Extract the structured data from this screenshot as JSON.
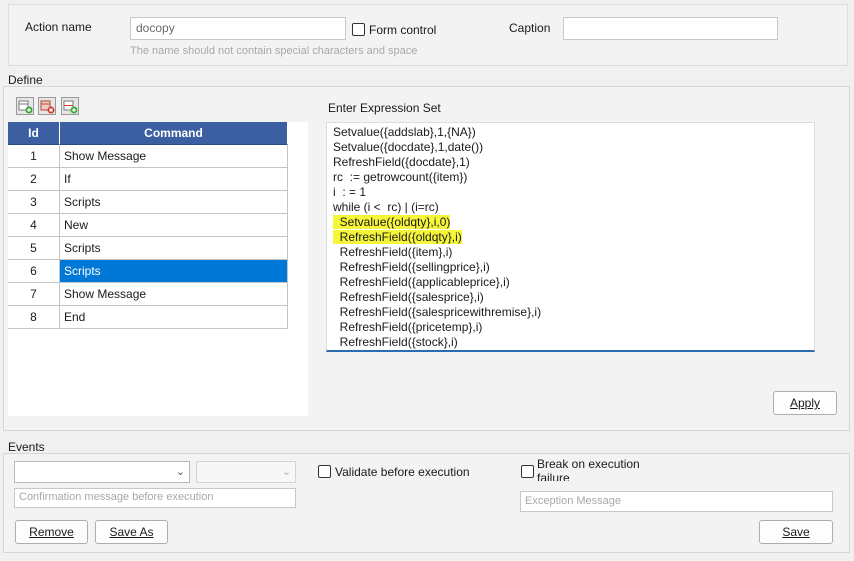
{
  "header": {
    "action_name_label": "Action name",
    "action_name_value": "docopy",
    "action_name_hint": "The name should not contain special characters and space",
    "form_control_label": "Form control",
    "caption_label": "Caption",
    "caption_value": ""
  },
  "define": {
    "legend": "Define",
    "toolbar": [
      "add-row-icon",
      "delete-row-icon",
      "insert-row-icon"
    ],
    "grid": {
      "columns": [
        "Id",
        "Command"
      ],
      "rows": [
        {
          "id": "1",
          "command": "Show Message"
        },
        {
          "id": "2",
          "command": "If"
        },
        {
          "id": "3",
          "command": "Scripts"
        },
        {
          "id": "4",
          "command": "New"
        },
        {
          "id": "5",
          "command": "Scripts"
        },
        {
          "id": "6",
          "command": "Scripts"
        },
        {
          "id": "7",
          "command": "Show Message"
        },
        {
          "id": "8",
          "command": "End"
        }
      ],
      "selected_row": 6
    },
    "expression_label": "Enter Expression Set",
    "expression_lines": [
      "Setvalue({addslab},1,{NA})",
      "Setvalue({docdate},1,date())",
      "RefreshField({docdate},1)",
      "rc  := getrowcount({item})",
      "i  : = 1",
      "while (i <  rc) | (i=rc)",
      "  Setvalue({oldqty},i,0)",
      "  RefreshField({oldqty},i)",
      "  RefreshField({item},i)",
      "  RefreshField({sellingprice},i)",
      "  RefreshField({applicableprice},i)",
      "  RefreshField({salesprice},i)",
      "  RefreshField({salespricewithremise},i)",
      "  RefreshField({pricetemp},i)",
      "  RefreshField({stock},i)"
    ],
    "highlight_color": "#f5f53a",
    "apply_label": "Apply"
  },
  "events": {
    "legend": "Events",
    "combo1_value": "",
    "combo2_value": "",
    "validate_label": "Validate before execution",
    "break_label": "Break on execution failure",
    "confirmation_placeholder": "Confirmation message before execution",
    "exception_placeholder": "Exception Message",
    "remove_label": "Remove",
    "save_as_label": "Save As",
    "save_label": "Save"
  },
  "colors": {
    "grid_header": "#3b5fa0",
    "selection": "#0078d7"
  }
}
